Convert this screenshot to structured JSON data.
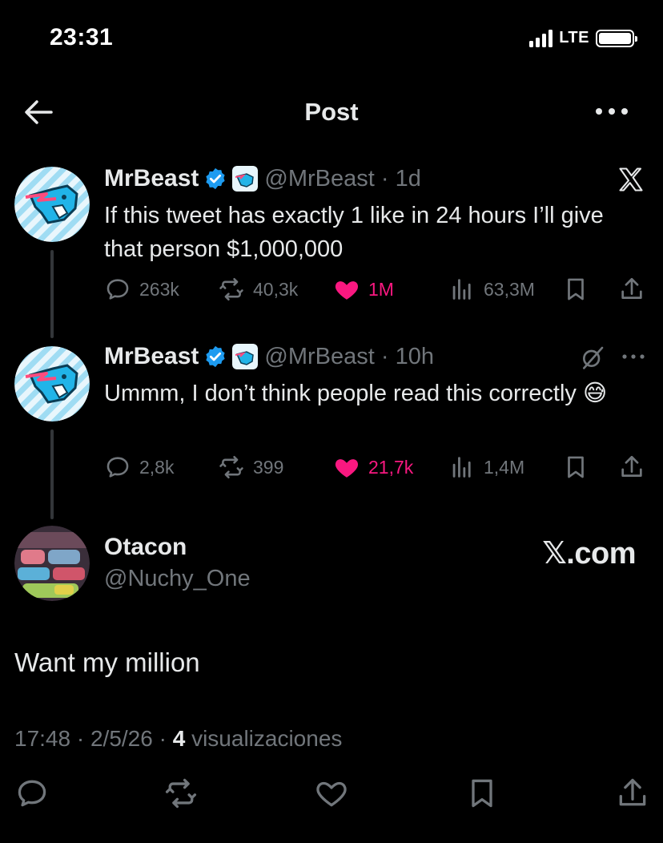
{
  "status": {
    "time": "23:31",
    "network": "LTE"
  },
  "nav": {
    "title": "Post"
  },
  "thread": [
    {
      "name": "MrBeast",
      "handle": "@MrBeast",
      "time": "1d",
      "text": "If this tweet has exactly 1 like in 24 hours I’ll give that person $1,000,000",
      "stats": {
        "replies": "263k",
        "reposts": "40,3k",
        "likes": "1M",
        "views": "63,3M"
      },
      "corner_icon": "x-logo-icon"
    },
    {
      "name": "MrBeast",
      "handle": "@MrBeast",
      "time": "10h",
      "text": "Ummm, I don’t think people read this correctly 😅",
      "stats": {
        "replies": "2,8k",
        "reposts": "399",
        "likes": "21,7k",
        "views": "1,4M"
      },
      "corner_icon": "grok-icon"
    }
  ],
  "reply": {
    "name": "Otacon",
    "handle": "@Nuchy_One",
    "text": "Want my million",
    "time": "17:48",
    "date": "2/5/26",
    "views_count": "4",
    "views_label": "visualizaciones"
  },
  "watermark": "𝕏.com",
  "colors": {
    "background": "#000000",
    "text": "#e7e9ea",
    "muted": "#71767b",
    "like": "#f91880",
    "verified": "#1d9bf0"
  }
}
